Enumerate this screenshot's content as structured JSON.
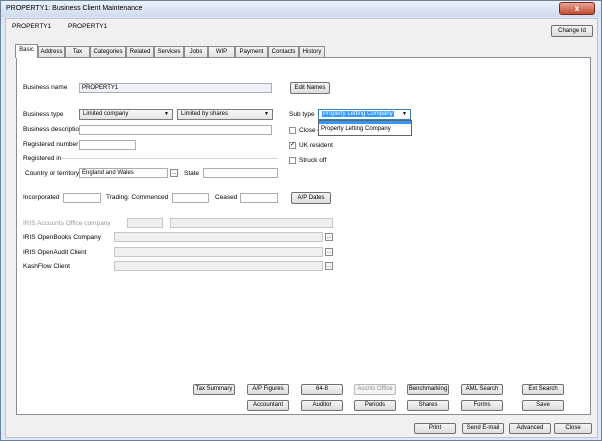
{
  "window": {
    "title": "PROPERTY1: Business Client Maintenance",
    "close_glyph": "x"
  },
  "header": {
    "code": "PROPERTY1",
    "name": "PROPERTY1",
    "change_id_label": "Change Id"
  },
  "tabs": [
    "Basic",
    "Address",
    "Tax",
    "Categories",
    "Related",
    "Services",
    "Jobs",
    "WIP",
    "Payment",
    "Contacts",
    "History"
  ],
  "form": {
    "business_name_label": "Business name",
    "business_name_value": "PROPERTY1",
    "edit_names_label": "Edit Names",
    "business_type_label": "Business type",
    "business_type_value": "Limited company",
    "share_type_value": "Limited by shares",
    "sub_type_label": "Sub type",
    "sub_type_value": "Property Letting Company",
    "sub_type_options": [
      "Property Letting Company"
    ],
    "business_description_label": "Business description",
    "registered_number_label": "Registered number",
    "registered_in_label": "Registered in",
    "close_company_label": "Close c",
    "uk_resident_label": "UK resident",
    "struck_off_label": "Struck off",
    "country_label": "Country or territory",
    "country_value": "England and Wales",
    "state_label": "State",
    "incorporated_label": "Incorporated",
    "trading_commenced_label": "Trading: Commenced",
    "ceased_label": "Ceased",
    "ap_dates_label": "A/P Dates",
    "iris_accounts_office_label": "IRIS Accounts Office company",
    "iris_openbooks_label": "IRIS OpenBooks Company",
    "iris_openaudit_label": "IRIS OpenAudit Client",
    "kashflow_label": "KashFlow Client",
    "lookup_glyph": "…",
    "check_glyph": "✓",
    "dropdown_glyph": "▼"
  },
  "actions": {
    "tax_summary": "Tax Summary",
    "ap_figures": "A/P Figures",
    "s64_8": "64-8",
    "accnts_office": "Accnts Office",
    "benchmarking": "Benchmarking",
    "aml_search": "AML Search",
    "ext_search": "Ext Search",
    "accountant": "Accountant",
    "auditor": "Auditor",
    "periods": "Periods",
    "shares": "Shares",
    "forms": "Forms",
    "save": "Save"
  },
  "footer": {
    "print": "Print",
    "send_email": "Send E-mail",
    "advanced": "Advanced",
    "close": "Close"
  }
}
